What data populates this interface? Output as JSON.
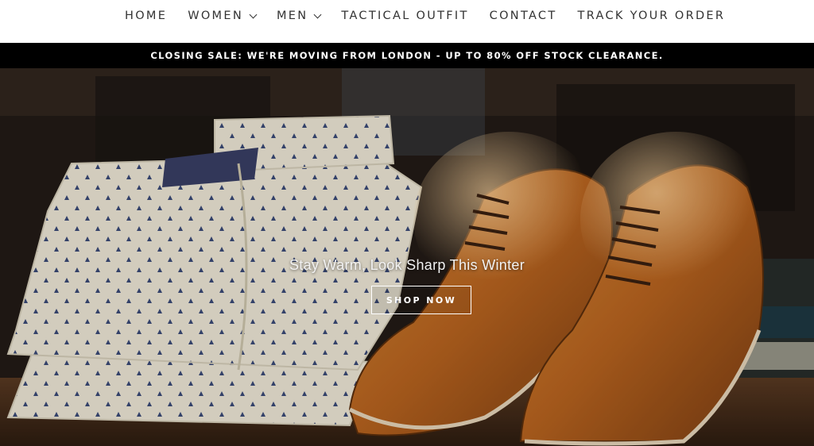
{
  "nav": {
    "items": [
      {
        "label": "HOME",
        "has_dropdown": false
      },
      {
        "label": "WOMEN",
        "has_dropdown": true
      },
      {
        "label": "MEN",
        "has_dropdown": true
      },
      {
        "label": "TACTICAL OUTFIT",
        "has_dropdown": false
      },
      {
        "label": "CONTACT",
        "has_dropdown": false
      },
      {
        "label": "TRACK YOUR ORDER",
        "has_dropdown": false
      }
    ]
  },
  "announcement": {
    "text": "CLOSING SALE: WE'RE MOVING FROM LONDON - UP TO 80% OFF STOCK CLEARANCE."
  },
  "hero": {
    "title": "Stay Warm, Look Sharp This Winter",
    "cta_label": "SHOP NOW",
    "image_subject": "folded patterned shirts and brown leather oxford shoes"
  },
  "colors": {
    "announcement_bg": "#000000",
    "nav_text": "#333333",
    "hero_text": "#ffffff"
  }
}
